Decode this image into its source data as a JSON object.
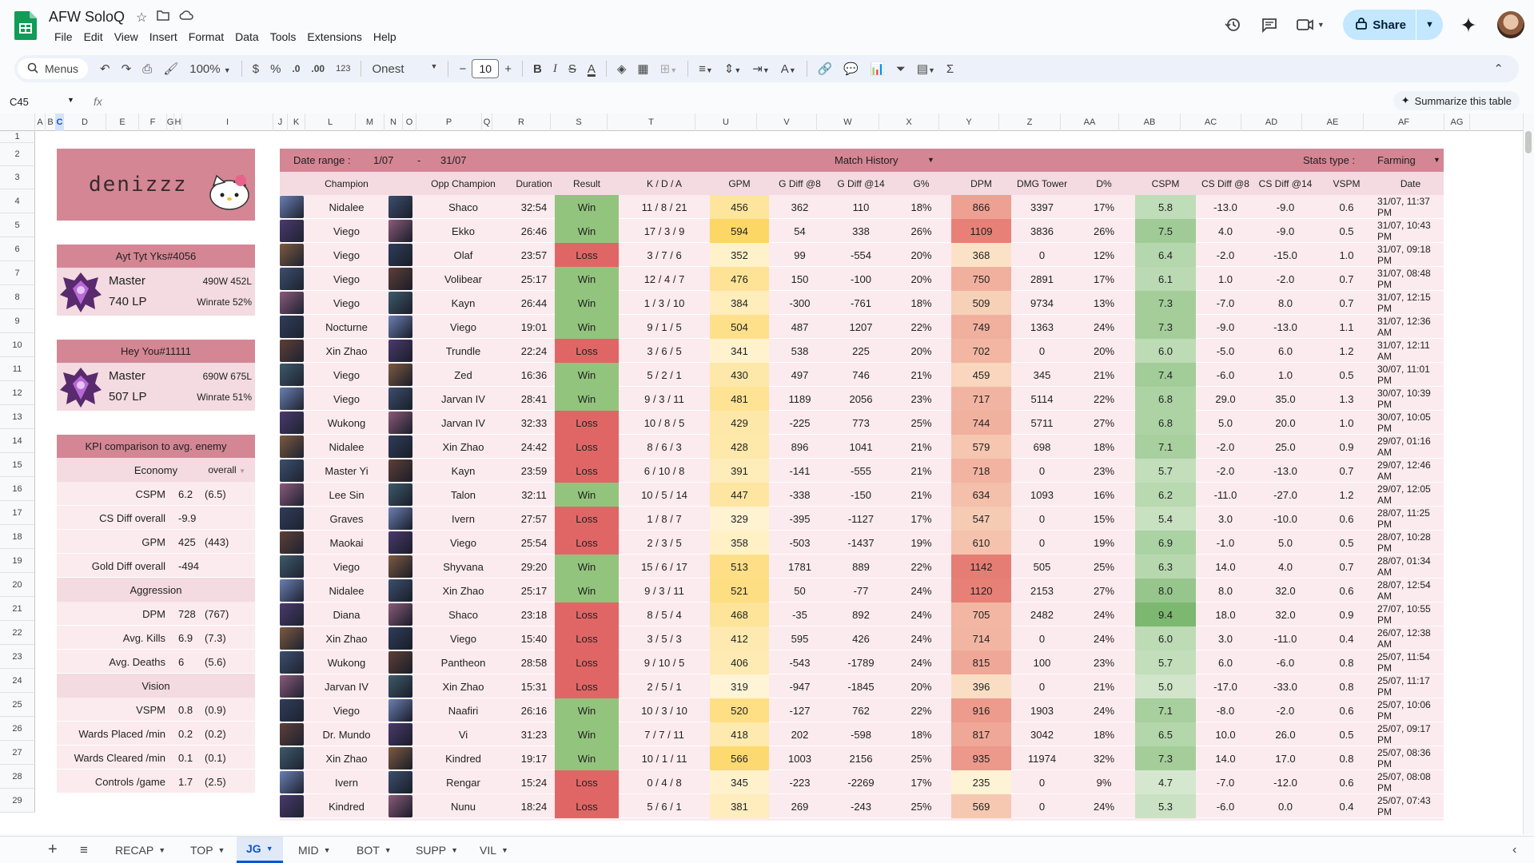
{
  "app": {
    "title": "AFW SoloQ",
    "menus": [
      "File",
      "Edit",
      "View",
      "Insert",
      "Format",
      "Data",
      "Tools",
      "Extensions",
      "Help"
    ],
    "share_label": "Share"
  },
  "toolbar": {
    "search_label": "Menus",
    "zoom": "100%",
    "currency": "$",
    "percent": "%",
    "dec_less": ".0",
    "dec_more": ".00",
    "numfmt": "123",
    "font": "Onest",
    "font_size": "10",
    "bold": "B",
    "italic": "I",
    "strike": "S",
    "textcolor": "A"
  },
  "formula": {
    "cell": "C45",
    "fx": "fx",
    "summarize": "Summarize this table"
  },
  "columns": [
    "A",
    "B",
    "C",
    "D",
    "E",
    "F",
    "G",
    "H",
    "I",
    "J",
    "K",
    "L",
    "M",
    "N",
    "O",
    "P",
    "Q",
    "R",
    "S",
    "T",
    "U",
    "V",
    "W",
    "X",
    "Y",
    "Z",
    "AA",
    "AB",
    "AC",
    "AD",
    "AE",
    "AF",
    "AG"
  ],
  "rows": [
    "1",
    "2",
    "3",
    "4",
    "5",
    "6",
    "7",
    "8",
    "9",
    "10",
    "11",
    "12",
    "13",
    "14",
    "15",
    "16",
    "17",
    "18",
    "19",
    "20",
    "21",
    "22",
    "23",
    "24",
    "25",
    "26",
    "27",
    "28",
    "29"
  ],
  "left_panel": {
    "player_name": "denizzz",
    "acc1": {
      "name": "Ayt Tyt Yks#4056",
      "tier": "Master",
      "lp": "740 LP",
      "record": "490W 452L",
      "winrate": "Winrate 52%"
    },
    "acc2": {
      "name": "Hey You#11111",
      "tier": "Master",
      "lp": "507 LP",
      "record": "690W 675L",
      "winrate": "Winrate 51%"
    },
    "kpi_title": "KPI comparison to avg. enemy",
    "kpi_filter": "overall",
    "kpi": [
      {
        "type": "section",
        "label": "Economy"
      },
      {
        "type": "row",
        "label": "CSPM",
        "value": "6.2",
        "avg": "(6.5)"
      },
      {
        "type": "row",
        "label": "CS Diff overall",
        "value": "-9.9",
        "avg": ""
      },
      {
        "type": "row",
        "label": "GPM",
        "value": "425",
        "avg": "(443)"
      },
      {
        "type": "row",
        "label": "Gold Diff overall",
        "value": "-494",
        "avg": ""
      },
      {
        "type": "section",
        "label": "Aggression"
      },
      {
        "type": "row",
        "label": "DPM",
        "value": "728",
        "avg": "(767)"
      },
      {
        "type": "row",
        "label": "Avg. Kills",
        "value": "6.9",
        "avg": "(7.3)"
      },
      {
        "type": "row",
        "label": "Avg. Deaths",
        "value": "6",
        "avg": "(5.6)"
      },
      {
        "type": "section",
        "label": "Vision"
      },
      {
        "type": "row",
        "label": "VSPM",
        "value": "0.8",
        "avg": "(0.9)"
      },
      {
        "type": "row",
        "label": "Wards Placed /min",
        "value": "0.2",
        "avg": "(0.2)"
      },
      {
        "type": "row",
        "label": "Wards Cleared /min",
        "value": "0.1",
        "avg": "(0.1)"
      },
      {
        "type": "row",
        "label": "Controls /game",
        "value": "1.7",
        "avg": "(2.5)"
      }
    ]
  },
  "match_table": {
    "date_range_label": "Date range :",
    "date_from": "1/07",
    "date_sep": "-",
    "date_to": "31/07",
    "title": "Match History",
    "stats_type_label": "Stats type :",
    "stats_type": "Farming",
    "headers": [
      "Champion",
      "Opp Champion",
      "Duration",
      "Result",
      "K / D / A",
      "GPM",
      "G Diff @8",
      "G Diff @14",
      "G%",
      "DPM",
      "DMG Tower",
      "D%",
      "CSPM",
      "CS Diff @8",
      "CS Diff @14",
      "VSPM",
      "Date"
    ],
    "rows": [
      [
        "Nidalee",
        "Shaco",
        "32:54",
        "Win",
        "11 / 8 / 21",
        "456",
        "362",
        "110",
        "18%",
        "866",
        "3397",
        "17%",
        "5.8",
        "-13.0",
        "-9.0",
        "0.6",
        "31/07, 11:37 PM"
      ],
      [
        "Viego",
        "Ekko",
        "26:46",
        "Win",
        "17 / 3 / 9",
        "594",
        "54",
        "338",
        "26%",
        "1109",
        "3836",
        "26%",
        "7.5",
        "4.0",
        "-9.0",
        "0.5",
        "31/07, 10:43 PM"
      ],
      [
        "Viego",
        "Olaf",
        "23:57",
        "Loss",
        "3 / 7 / 6",
        "352",
        "99",
        "-554",
        "20%",
        "368",
        "0",
        "12%",
        "6.4",
        "-2.0",
        "-15.0",
        "1.0",
        "31/07, 09:18 PM"
      ],
      [
        "Viego",
        "Volibear",
        "25:17",
        "Win",
        "12 / 4 / 7",
        "476",
        "150",
        "-100",
        "20%",
        "750",
        "2891",
        "17%",
        "6.1",
        "1.0",
        "-2.0",
        "0.7",
        "31/07, 08:48 PM"
      ],
      [
        "Viego",
        "Kayn",
        "26:44",
        "Win",
        "1 / 3 / 10",
        "384",
        "-300",
        "-761",
        "18%",
        "509",
        "9734",
        "13%",
        "7.3",
        "-7.0",
        "8.0",
        "0.7",
        "31/07, 12:15 PM"
      ],
      [
        "Nocturne",
        "Viego",
        "19:01",
        "Win",
        "9 / 1 / 5",
        "504",
        "487",
        "1207",
        "22%",
        "749",
        "1363",
        "24%",
        "7.3",
        "-9.0",
        "-13.0",
        "1.1",
        "31/07, 12:36 AM"
      ],
      [
        "Xin Zhao",
        "Trundle",
        "22:24",
        "Loss",
        "3 / 6 / 5",
        "341",
        "538",
        "225",
        "20%",
        "702",
        "0",
        "20%",
        "6.0",
        "-5.0",
        "6.0",
        "1.2",
        "31/07, 12:11 AM"
      ],
      [
        "Viego",
        "Zed",
        "16:36",
        "Win",
        "5 / 2 / 1",
        "430",
        "497",
        "746",
        "21%",
        "459",
        "345",
        "21%",
        "7.4",
        "-6.0",
        "1.0",
        "0.5",
        "30/07, 11:01 PM"
      ],
      [
        "Viego",
        "Jarvan IV",
        "28:41",
        "Win",
        "9 / 3 / 11",
        "481",
        "1189",
        "2056",
        "23%",
        "717",
        "5114",
        "22%",
        "6.8",
        "29.0",
        "35.0",
        "1.3",
        "30/07, 10:39 PM"
      ],
      [
        "Wukong",
        "Jarvan IV",
        "32:33",
        "Loss",
        "10 / 8 / 5",
        "429",
        "-225",
        "773",
        "25%",
        "744",
        "5711",
        "27%",
        "6.8",
        "5.0",
        "20.0",
        "1.0",
        "30/07, 10:05 PM"
      ],
      [
        "Nidalee",
        "Xin Zhao",
        "24:42",
        "Loss",
        "8 / 6 / 3",
        "428",
        "896",
        "1041",
        "21%",
        "579",
        "698",
        "18%",
        "7.1",
        "-2.0",
        "25.0",
        "0.9",
        "29/07, 01:16 AM"
      ],
      [
        "Master Yi",
        "Kayn",
        "23:59",
        "Loss",
        "6 / 10 / 8",
        "391",
        "-141",
        "-555",
        "21%",
        "718",
        "0",
        "23%",
        "5.7",
        "-2.0",
        "-13.0",
        "0.7",
        "29/07, 12:46 AM"
      ],
      [
        "Lee Sin",
        "Talon",
        "32:11",
        "Win",
        "10 / 5 / 14",
        "447",
        "-338",
        "-150",
        "21%",
        "634",
        "1093",
        "16%",
        "6.2",
        "-11.0",
        "-27.0",
        "1.2",
        "29/07, 12:05 AM"
      ],
      [
        "Graves",
        "Ivern",
        "27:57",
        "Loss",
        "1 / 8 / 7",
        "329",
        "-395",
        "-1127",
        "17%",
        "547",
        "0",
        "15%",
        "5.4",
        "3.0",
        "-10.0",
        "0.6",
        "28/07, 11:25 PM"
      ],
      [
        "Maokai",
        "Viego",
        "25:54",
        "Loss",
        "2 / 3 / 5",
        "358",
        "-503",
        "-1437",
        "19%",
        "610",
        "0",
        "19%",
        "6.9",
        "-1.0",
        "5.0",
        "0.5",
        "28/07, 10:28 PM"
      ],
      [
        "Viego",
        "Shyvana",
        "29:20",
        "Win",
        "15 / 6 / 17",
        "513",
        "1781",
        "889",
        "22%",
        "1142",
        "505",
        "25%",
        "6.3",
        "14.0",
        "4.0",
        "0.7",
        "28/07, 01:34 AM"
      ],
      [
        "Nidalee",
        "Xin Zhao",
        "25:17",
        "Win",
        "9 / 3 / 11",
        "521",
        "50",
        "-77",
        "24%",
        "1120",
        "2153",
        "27%",
        "8.0",
        "8.0",
        "32.0",
        "0.6",
        "28/07, 12:54 AM"
      ],
      [
        "Diana",
        "Shaco",
        "23:18",
        "Loss",
        "8 / 5 / 4",
        "468",
        "-35",
        "892",
        "24%",
        "705",
        "2482",
        "24%",
        "9.4",
        "18.0",
        "32.0",
        "0.9",
        "27/07, 10:55 PM"
      ],
      [
        "Xin Zhao",
        "Viego",
        "15:40",
        "Loss",
        "3 / 5 / 3",
        "412",
        "595",
        "426",
        "24%",
        "714",
        "0",
        "24%",
        "6.0",
        "3.0",
        "-11.0",
        "0.4",
        "26/07, 12:38 AM"
      ],
      [
        "Wukong",
        "Pantheon",
        "28:58",
        "Loss",
        "9 / 10 / 5",
        "406",
        "-543",
        "-1789",
        "24%",
        "815",
        "100",
        "23%",
        "5.7",
        "6.0",
        "-6.0",
        "0.8",
        "25/07, 11:54 PM"
      ],
      [
        "Jarvan IV",
        "Xin Zhao",
        "15:31",
        "Loss",
        "2 / 5 / 1",
        "319",
        "-947",
        "-1845",
        "20%",
        "396",
        "0",
        "21%",
        "5.0",
        "-17.0",
        "-33.0",
        "0.8",
        "25/07, 11:17 PM"
      ],
      [
        "Viego",
        "Naafiri",
        "26:16",
        "Win",
        "10 / 3 / 10",
        "520",
        "-127",
        "762",
        "22%",
        "916",
        "1903",
        "24%",
        "7.1",
        "-8.0",
        "-2.0",
        "0.6",
        "25/07, 10:06 PM"
      ],
      [
        "Dr. Mundo",
        "Vi",
        "31:23",
        "Win",
        "7 / 7 / 11",
        "418",
        "202",
        "-598",
        "18%",
        "817",
        "3042",
        "18%",
        "6.5",
        "10.0",
        "26.0",
        "0.5",
        "25/07, 09:17 PM"
      ],
      [
        "Xin Zhao",
        "Kindred",
        "19:17",
        "Win",
        "10 / 1 / 11",
        "566",
        "1003",
        "2156",
        "25%",
        "935",
        "11974",
        "32%",
        "7.3",
        "14.0",
        "17.0",
        "0.8",
        "25/07, 08:36 PM"
      ],
      [
        "Ivern",
        "Rengar",
        "15:24",
        "Loss",
        "0 / 4 / 8",
        "345",
        "-223",
        "-2269",
        "17%",
        "235",
        "0",
        "9%",
        "4.7",
        "-7.0",
        "-12.0",
        "0.6",
        "25/07, 08:08 PM"
      ],
      [
        "Kindred",
        "Nunu",
        "18:24",
        "Loss",
        "5 / 6 / 1",
        "381",
        "269",
        "-243",
        "25%",
        "569",
        "0",
        "24%",
        "5.3",
        "-6.0",
        "0.0",
        "0.4",
        "25/07, 07:43 PM"
      ]
    ]
  },
  "tabs": [
    "RECAP",
    "TOP",
    "JG",
    "MID",
    "BOT",
    "SUPP",
    "VIL"
  ],
  "colors": {
    "header_pink": "#d48694",
    "light_pink": "#f3dbe1",
    "row_pink": "#fbeaee",
    "win": "#93c47d",
    "loss": "#e06666",
    "gpm_high": "#fdd663",
    "dpm_high": "#e67c73",
    "cspm_high": "#93c47d"
  }
}
